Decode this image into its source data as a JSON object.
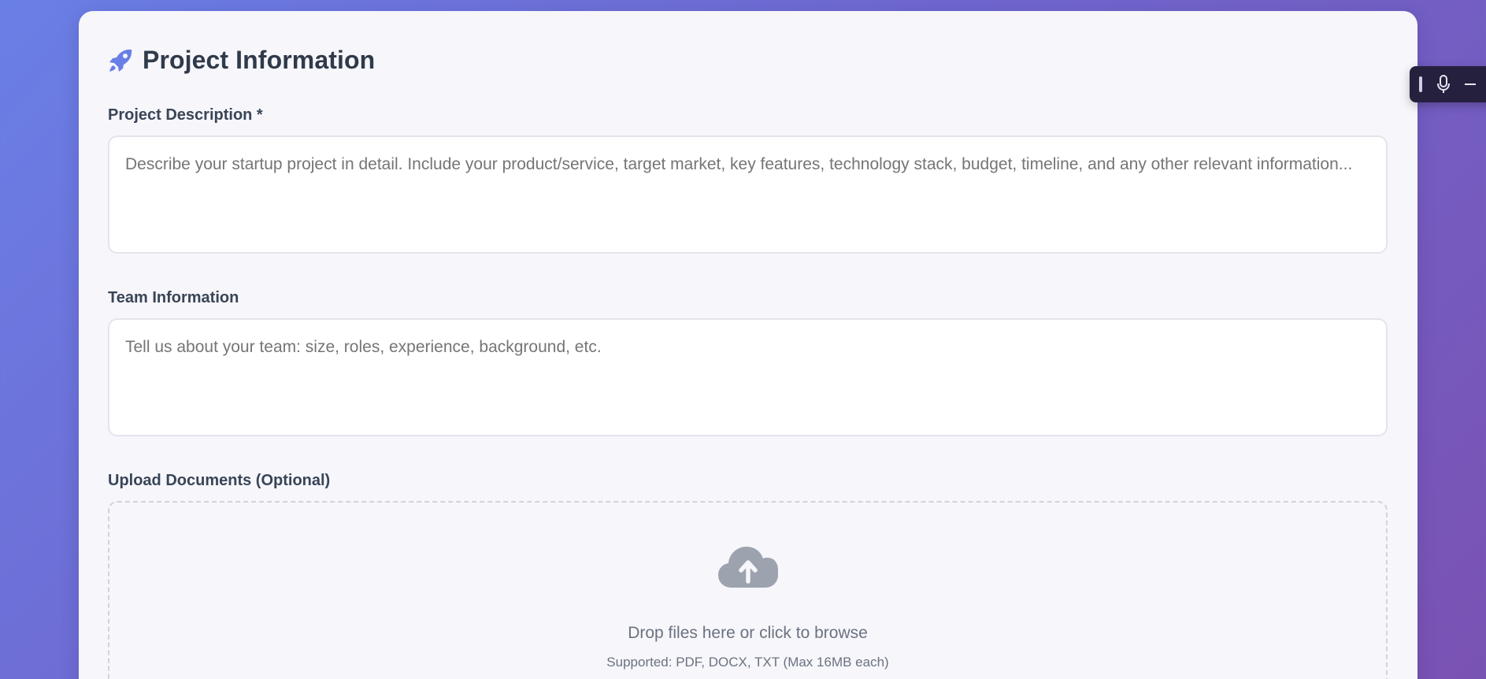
{
  "header": {
    "icon": "rocket-icon",
    "title": "Project Information"
  },
  "fields": {
    "description": {
      "label": "Project Description *",
      "placeholder": "Describe your startup project in detail. Include your product/service, target market, key features, technology stack, budget, timeline, and any other relevant information...",
      "value": ""
    },
    "team": {
      "label": "Team Information",
      "placeholder": "Tell us about your team: size, roles, experience, background, etc.",
      "value": ""
    },
    "upload": {
      "label": "Upload Documents (Optional)",
      "icon": "cloud-upload-icon",
      "main_text": "Drop files here or click to browse",
      "sub_text": "Supported: PDF, DOCX, TXT (Max 16MB each)"
    }
  },
  "toolbar": {
    "icons": [
      "drag-handle-icon",
      "microphone-icon"
    ]
  },
  "colors": {
    "accent": "#6a7fe6",
    "title_text": "#2f3a4a",
    "placeholder": "#8a8f99",
    "card_bg": "#f6f6fb"
  }
}
